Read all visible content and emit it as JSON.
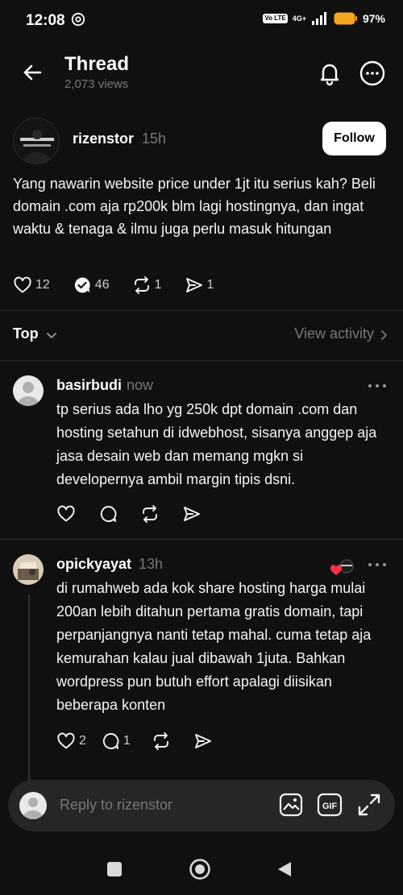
{
  "status": {
    "time": "12:08",
    "network": "4G+",
    "volte": "Vo LTE",
    "battery": "97%"
  },
  "header": {
    "title": "Thread",
    "views": "2,073 views"
  },
  "post": {
    "username": "rizenstor",
    "time": "15h",
    "follow_label": "Follow",
    "body": "Yang nawarin website price under 1jt itu serius kah? Beli domain .com aja rp200k blm lagi hostingnya, dan ingat waktu & tenaga & ilmu juga perlu masuk hitungan",
    "likes": "12",
    "replies": "46",
    "reposts": "1",
    "shares": "1"
  },
  "sort": {
    "label": "Top",
    "view_activity": "View activity"
  },
  "replies": [
    {
      "username": "basirbudi",
      "time": "now",
      "body": "tp serius ada lho yg 250k dpt domain .com dan hosting setahun di idwebhost, sisanya anggep aja jasa desain web dan memang mgkn si developernya ambil margin tipis dsni."
    },
    {
      "username": "opickyayat",
      "time": "13h",
      "body": "di rumahweb ada kok share hosting harga mulai 200an lebih ditahun pertama gratis domain, tapi perpanjangnya nanti tetap mahal. cuma tetap aja kemurahan kalau jual dibawah 1juta. Bahkan wordpress pun butuh effort apalagi diisikan beberapa konten",
      "likes": "2",
      "comments": "1"
    }
  ],
  "reply_bar": {
    "placeholder": "Reply to rizenstor"
  },
  "icons": {
    "back": "arrow-left-icon",
    "bell": "bell-icon",
    "more": "more-icon",
    "heart": "heart-icon",
    "comment": "comment-icon",
    "repost": "repost-icon",
    "share": "send-icon",
    "gif": "gif-icon",
    "image": "image-icon",
    "expand": "expand-icon"
  }
}
